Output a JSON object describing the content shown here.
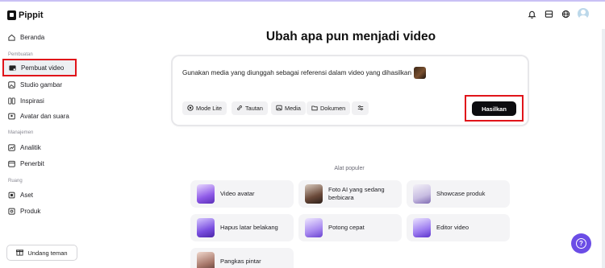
{
  "app": {
    "name": "Pippit"
  },
  "sidebar": {
    "home": "Beranda",
    "section_create": "Pembuatan",
    "create_items": [
      "Pembuat video",
      "Studio gambar",
      "Inspirasi",
      "Avatar dan suara"
    ],
    "section_manage": "Manajemen",
    "manage_items": [
      "Analitik",
      "Penerbit"
    ],
    "section_space": "Ruang",
    "space_items": [
      "Aset",
      "Produk"
    ],
    "invite": "Undang teman"
  },
  "main": {
    "title": "Ubah apa pun menjadi video",
    "prompt": "Gunakan media yang diunggah sebagai referensi dalam video yang dihasilkan",
    "chips": [
      "Mode Lite",
      "Tautan",
      "Media",
      "Dokumen"
    ],
    "generate": "Hasilkan"
  },
  "tools": {
    "title": "Alat populer",
    "items": [
      "Video avatar",
      "Foto AI yang sedang berbicara",
      "Showcase produk",
      "Hapus latar belakang",
      "Potong cepat",
      "Editor video",
      "Pangkas pintar"
    ]
  },
  "icons": [
    "bell-icon",
    "inbox-icon",
    "globe-icon",
    "avatar",
    "help-icon"
  ],
  "colors": {
    "accent": "#6b4de6",
    "highlight_border": "#e0141a",
    "primary_button": "#0c0c0f"
  }
}
